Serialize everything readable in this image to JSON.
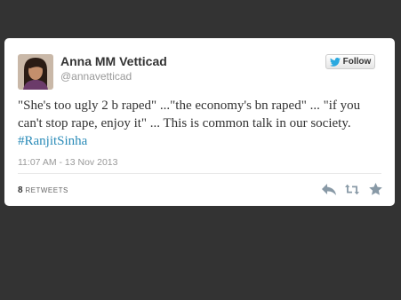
{
  "author": {
    "name": "Anna MM Vetticad",
    "handle": "@annavetticad"
  },
  "follow_button": {
    "label": "Follow",
    "icon": "twitter-bird-icon"
  },
  "tweet": {
    "text": "\"She's too ugly 2 b raped\" ...\"the economy's bn raped\" ... \"if you can't stop rape, enjoy it\" ... This is common talk in our society. ",
    "hashtag": "#RanjitSinha",
    "timestamp": "11:07 AM - 13 Nov 2013"
  },
  "stats": {
    "retweet_count": "8",
    "retweet_label": "RETWEETS"
  },
  "actions": [
    {
      "icon": "reply-icon"
    },
    {
      "icon": "retweet-icon"
    },
    {
      "icon": "favorite-star-icon"
    }
  ],
  "colors": {
    "background": "#333333",
    "card": "#ffffff",
    "link": "#2a8bb8",
    "muted": "#999999",
    "icon": "#8899a6"
  }
}
